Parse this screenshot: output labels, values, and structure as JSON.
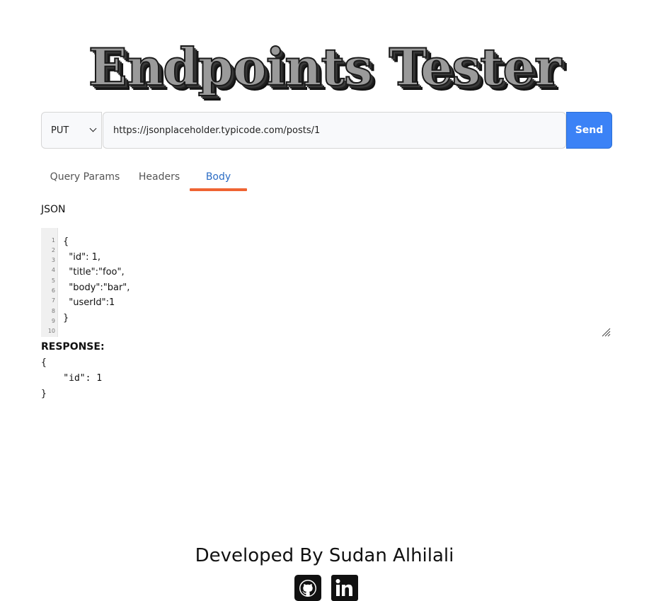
{
  "header": {
    "title": "Endpoints Tester"
  },
  "request": {
    "method": "PUT",
    "url": "https://jsonplaceholder.typicode.com/posts/1",
    "send_label": "Send"
  },
  "tabs": [
    {
      "label": "Query Params",
      "active": false
    },
    {
      "label": "Headers",
      "active": false
    },
    {
      "label": "Body",
      "active": true
    }
  ],
  "body_editor": {
    "label": "JSON",
    "line_numbers": [
      "1",
      "2",
      "3",
      "4",
      "5",
      "6",
      "7",
      "8",
      "9",
      "10"
    ],
    "lines": [
      "{",
      "  \"id\": 1,",
      "  \"title\":\"foo\",",
      "  \"body\":\"bar\",",
      "  \"userId\":1",
      "}"
    ]
  },
  "response": {
    "label": "RESPONSE:",
    "text": "{\n    \"id\": 1\n}"
  },
  "footer": {
    "credit": "Developed By Sudan Alhilali",
    "links": [
      "github-icon",
      "linkedin-icon"
    ]
  },
  "colors": {
    "accent": "#3b82f6",
    "active_tab": "#2b6cc4",
    "tab_indicator": "#ef6433"
  }
}
